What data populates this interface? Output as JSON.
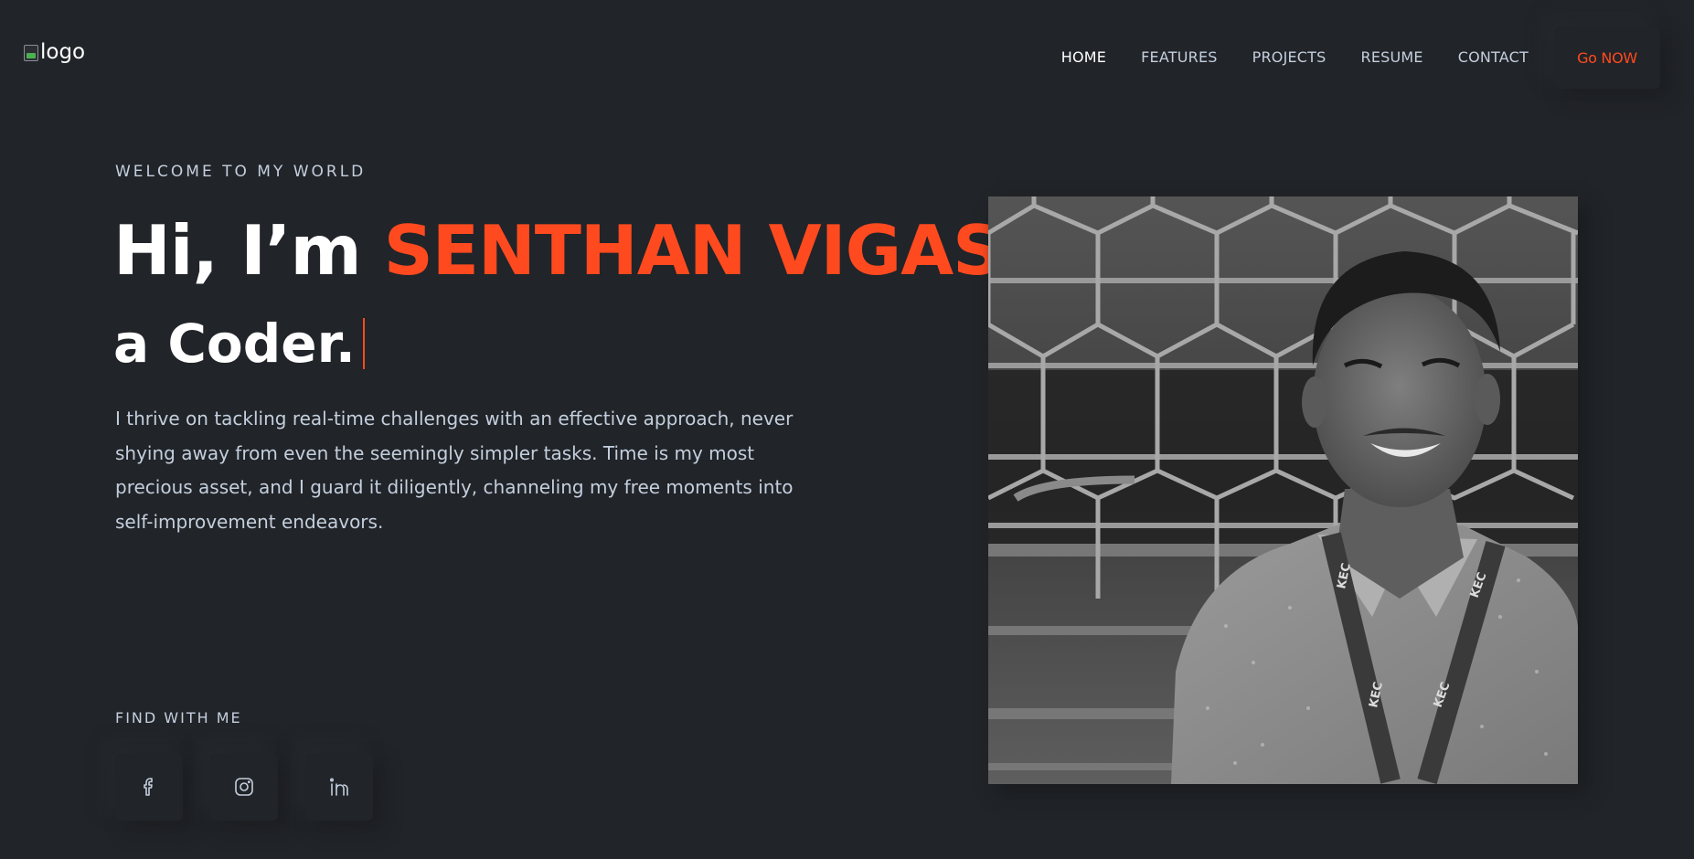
{
  "header": {
    "logo_alt": "logo",
    "nav": [
      "HOME",
      "FEATURES",
      "PROJECTS",
      "RESUME",
      "CONTACT"
    ],
    "active_nav": "HOME",
    "cta_label": "Go NOW"
  },
  "hero": {
    "welcome": "WELCOME TO MY WORLD",
    "greeting": "Hi, I’m ",
    "name": "SENTHAN VIGAS",
    "role": "a Coder.",
    "bio": "I thrive on tackling real-time challenges with an effective approach, never shying away from even the seemingly simpler tasks. Time is my most precious asset, and I guard it diligently, channeling my free moments into self-improvement endeavors."
  },
  "find": {
    "title": "FIND WITH ME",
    "icons": [
      "facebook-icon",
      "instagram-icon",
      "linkedin-icon"
    ]
  },
  "portrait": {
    "lanyard_text": "KEC"
  },
  "colors": {
    "background": "#212428",
    "accent": "#ff4a1f",
    "text": "#c4cfde",
    "heading": "#ffffff"
  }
}
